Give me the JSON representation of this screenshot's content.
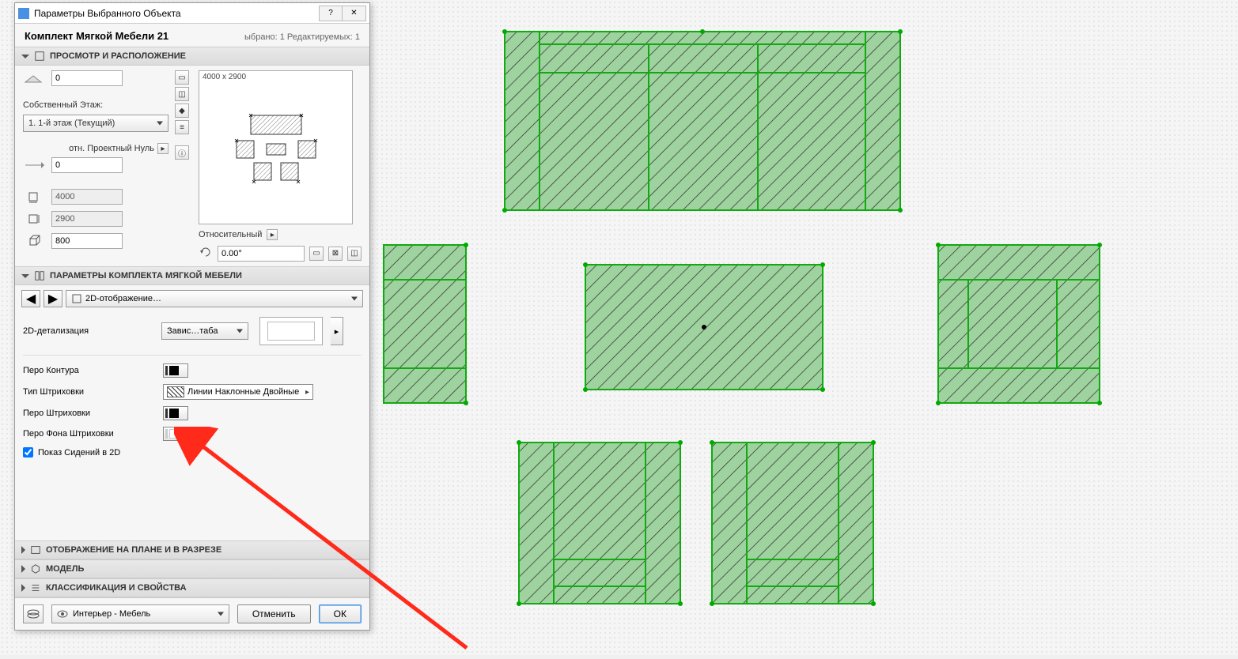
{
  "window": {
    "title": "Параметры Выбранного Объекта"
  },
  "object": {
    "name": "Комплект Мягкой Мебели 21",
    "selected_editable": "ыбрано: 1 Редактируемых: 1"
  },
  "sections": {
    "preview": "ПРОСМОТР И РАСПОЛОЖЕНИЕ",
    "params": "ПАРАМЕТРЫ КОМПЛЕКТА МЯГКОЙ МЕБЕЛИ",
    "plan": "ОТОБРАЖЕНИЕ НА ПЛАНЕ И В РАЗРЕЗЕ",
    "model": "МОДЕЛЬ",
    "classification": "КЛАССИФИКАЦИЯ И СВОЙСТВА"
  },
  "preview": {
    "size_label": "4000 x 2900",
    "elevation_top": "0",
    "own_floor_label": "Собственный Этаж:",
    "own_floor_value": "1. 1-й этаж (Текущий)",
    "project_zero_label": "отн. Проектный Нуль",
    "project_zero_value": "0",
    "dim_x": "4000",
    "dim_y": "2900",
    "dim_z": "800",
    "rel_label": "Относительный",
    "angle": "0.00°"
  },
  "params_page": {
    "page_name": "2D-отображение…",
    "detail_label": "2D-детализация",
    "detail_value": "Завис…таба"
  },
  "pens": {
    "contour": "Перо Контура",
    "hatch_type": "Тип Штриховки",
    "hatch_name": "Линии Наклонные Двойные",
    "hatch_pen": "Перо Штриховки",
    "hatch_bg": "Перо Фона Штриховки",
    "show_seats": "Показ Сидений в 2D"
  },
  "footer": {
    "layer": "Интерьер - Мебель",
    "cancel": "Отменить",
    "ok": "ОК"
  }
}
